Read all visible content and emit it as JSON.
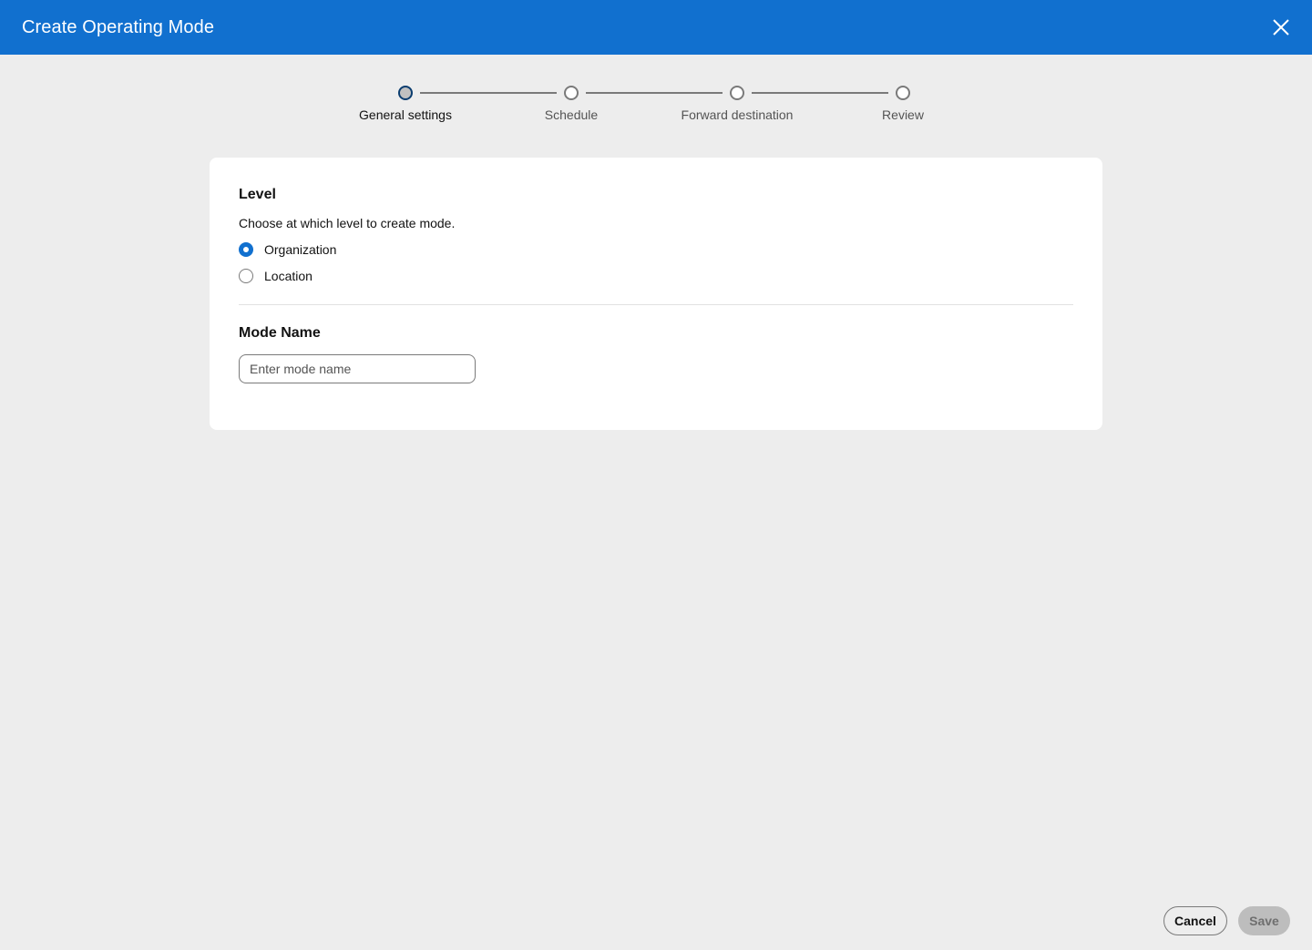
{
  "header": {
    "title": "Create Operating Mode",
    "close_icon": "close-icon"
  },
  "stepper": {
    "steps": [
      {
        "label": "General settings",
        "state": "active"
      },
      {
        "label": "Schedule",
        "state": "pending"
      },
      {
        "label": "Forward destination",
        "state": "pending"
      },
      {
        "label": "Review",
        "state": "pending"
      }
    ]
  },
  "level": {
    "title": "Level",
    "description": "Choose at which level to create mode.",
    "options": [
      {
        "label": "Organization",
        "checked": true
      },
      {
        "label": "Location",
        "checked": false
      }
    ]
  },
  "mode_name": {
    "title": "Mode Name",
    "placeholder": "Enter mode name",
    "value": ""
  },
  "footer": {
    "cancel_label": "Cancel",
    "save_label": "Save",
    "save_disabled": true
  },
  "colors": {
    "brand": "#1170cf",
    "background": "#ededed"
  }
}
